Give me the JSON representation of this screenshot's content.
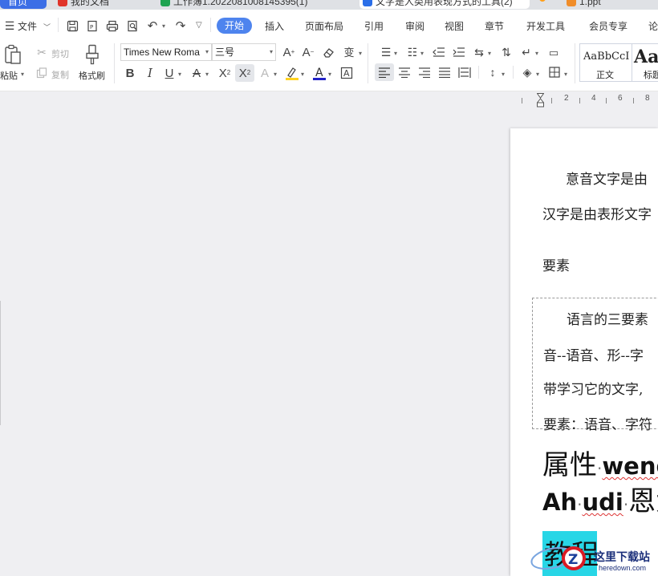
{
  "tabs": [
    {
      "label": "首页",
      "active": true
    },
    {
      "label": "我的文档",
      "color": "#e0342a"
    },
    {
      "label": "工作簿1.2022081008145395(1)",
      "color": "#1fa351"
    },
    {
      "label": "文字是人类用表现方式的工具(2)",
      "color": "#2a6ee8"
    },
    {
      "label": "1.ppt",
      "color": "#f08d2a"
    }
  ],
  "menu": {
    "file_label": "文件",
    "items": [
      "开始",
      "插入",
      "页面布局",
      "引用",
      "审阅",
      "视图",
      "章节",
      "开发工具",
      "会员专享",
      "论"
    ]
  },
  "ribbon": {
    "paste_label": "粘贴",
    "cut_label": "剪切",
    "copy_label": "复制",
    "format_painter_label": "格式刷",
    "font_name": "Times New Roma",
    "font_size": "三号",
    "styles": [
      {
        "preview": "AaBbCcI",
        "label": "正文"
      },
      {
        "preview": "Aa",
        "label": "标题"
      }
    ]
  },
  "ruler": {
    "marks": [
      "2",
      "4",
      "6",
      "8"
    ]
  },
  "document": {
    "para1": "意音文字是由",
    "para2": "汉字是由表形文字",
    "heading": "要素",
    "box_line1": "语言的三要素",
    "box_line2": "音--语音、形--字",
    "box_line3": "带学习它的文字,",
    "box_line4": "要素：语音、字符",
    "big_line1_a": "属性",
    "big_line1_b": "wend",
    "big_line2_a": "Ah",
    "big_line2_b": "udi",
    "big_line2_c": "恩大",
    "highlight_text": "教程"
  },
  "watermark": {
    "title": "这里下载站",
    "url": "heredown.com"
  },
  "colors": {
    "accent": "#4e84ee",
    "home_tab": "#3c6ee6",
    "highlight": "#28d6e6",
    "font_color_bar": "#2323c8",
    "highlight_bar": "#ffd21f"
  }
}
